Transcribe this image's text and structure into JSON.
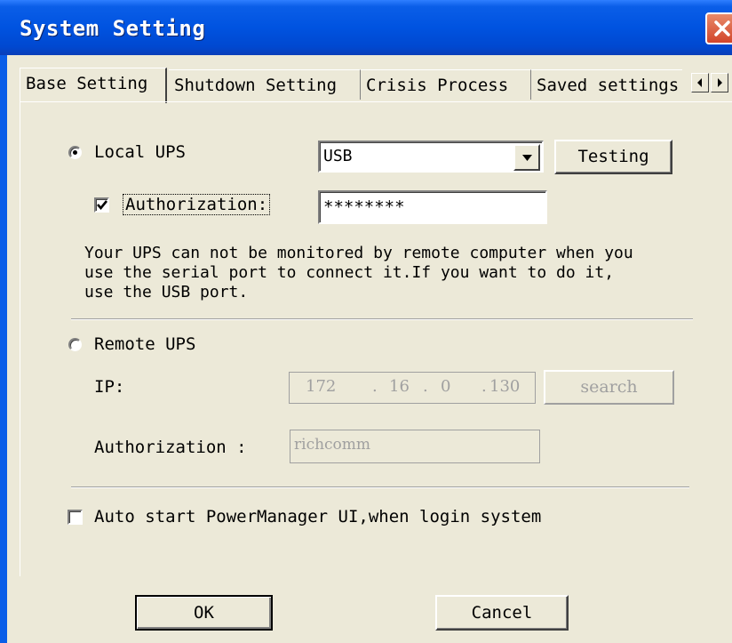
{
  "window": {
    "title": "System Setting"
  },
  "tabs": [
    {
      "label": "Base Setting",
      "active": true
    },
    {
      "label": "Shutdown Setting",
      "active": false
    },
    {
      "label": "Crisis Process",
      "active": false
    },
    {
      "label": "Saved settings",
      "active": false
    }
  ],
  "local_ups": {
    "label": "Local UPS",
    "selected": true,
    "port_value": "USB",
    "testing_label": "Testing",
    "authorization_label": "Authorization:",
    "authorization_checked": true,
    "authorization_value": "********",
    "info_text": "Your UPS can not be monitored by remote computer when you\nuse the serial port to connect it.If you want to do it,\nuse the USB port."
  },
  "remote_ups": {
    "label": "Remote UPS",
    "selected": false,
    "ip_label": "IP:",
    "ip_octets": [
      "172",
      "16",
      "0",
      "130"
    ],
    "search_label": "search",
    "authorization_label": "Authorization :",
    "authorization_value": "richcomm"
  },
  "autostart": {
    "label": "Auto start PowerManager UI,when login system",
    "checked": false
  },
  "footer": {
    "ok_label": "OK",
    "cancel_label": "Cancel"
  },
  "icons": [
    "close-icon",
    "tab-scroll-left-icon",
    "tab-scroll-right-icon",
    "dropdown-arrow-icon",
    "checkmark-icon",
    "radio-dot-icon"
  ],
  "colors": {
    "titlebar": "#0053e0",
    "dialog_bg": "#ece9d8",
    "close_button": "#d2452a",
    "disabled_text": "#a0a0a0"
  }
}
